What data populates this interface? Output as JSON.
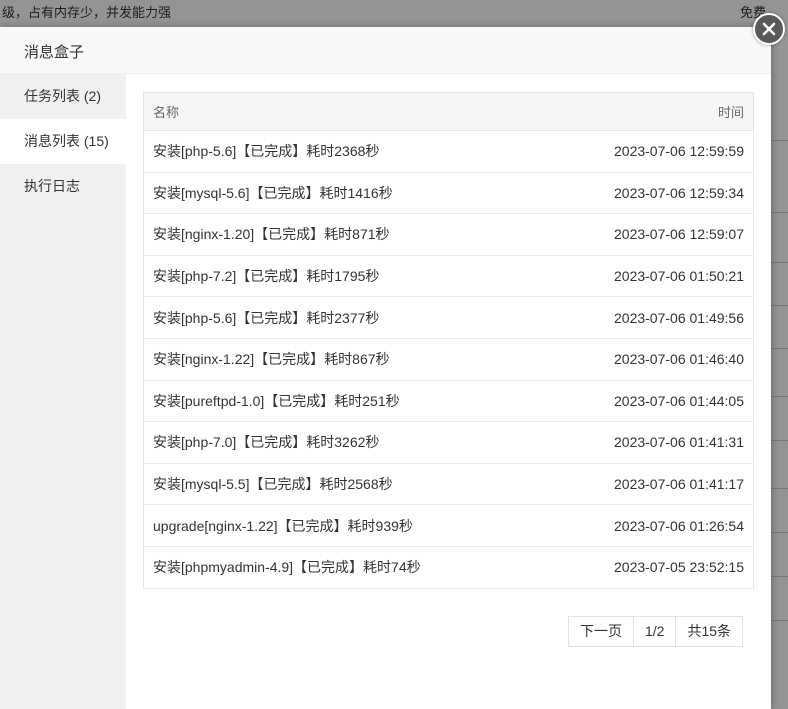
{
  "background": {
    "top_text_left": "级，占有内存少，并发能力强",
    "top_text_right": "免费"
  },
  "dialog": {
    "title": "消息盒子",
    "close_icon": "close-icon",
    "sidebar": [
      {
        "label": "任务列表 (2)",
        "active": false
      },
      {
        "label": "消息列表 (15)",
        "active": true
      },
      {
        "label": "执行日志",
        "active": false
      }
    ],
    "table": {
      "headers": {
        "name": "名称",
        "time": "时间"
      },
      "rows": [
        {
          "name": "安装[php-5.6]【已完成】耗时2368秒",
          "time": "2023-07-06 12:59:59"
        },
        {
          "name": "安装[mysql-5.6]【已完成】耗时1416秒",
          "time": "2023-07-06 12:59:34"
        },
        {
          "name": "安装[nginx-1.20]【已完成】耗时871秒",
          "time": "2023-07-06 12:59:07"
        },
        {
          "name": "安装[php-7.2]【已完成】耗时1795秒",
          "time": "2023-07-06 01:50:21"
        },
        {
          "name": "安装[php-5.6]【已完成】耗时2377秒",
          "time": "2023-07-06 01:49:56"
        },
        {
          "name": "安装[nginx-1.22]【已完成】耗时867秒",
          "time": "2023-07-06 01:46:40"
        },
        {
          "name": "安装[pureftpd-1.0]【已完成】耗时251秒",
          "time": "2023-07-06 01:44:05"
        },
        {
          "name": "安装[php-7.0]【已完成】耗时3262秒",
          "time": "2023-07-06 01:41:31"
        },
        {
          "name": "安装[mysql-5.5]【已完成】耗时2568秒",
          "time": "2023-07-06 01:41:17"
        },
        {
          "name": "upgrade[nginx-1.22]【已完成】耗时939秒",
          "time": "2023-07-06 01:26:54"
        },
        {
          "name": "安装[phpmyadmin-4.9]【已完成】耗时74秒",
          "time": "2023-07-05 23:52:15"
        }
      ]
    },
    "pagination": {
      "next": "下一页",
      "page": "1/2",
      "total": "共15条"
    }
  }
}
